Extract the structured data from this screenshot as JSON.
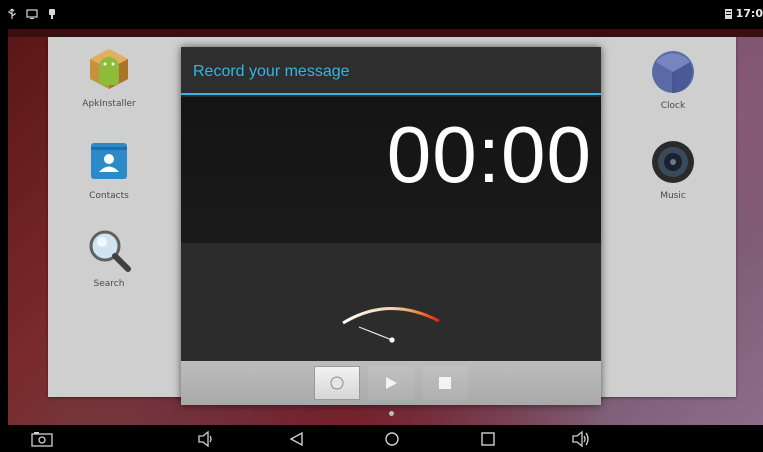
{
  "status_bar": {
    "icons_left": [
      "usb-icon",
      "screen-icon",
      "notification-icon"
    ],
    "clock": "17:0",
    "battery_icon": "sd-card-icon"
  },
  "launcher": {
    "apps_left": [
      {
        "label": "ApkInstaller",
        "icon": "apkinstaller-icon"
      },
      {
        "label": "Contacts",
        "icon": "contacts-icon"
      },
      {
        "label": "Search",
        "icon": "search-icon"
      }
    ],
    "apps_right": [
      {
        "label": "Clock",
        "icon": "clock-icon"
      },
      {
        "label": "Music",
        "icon": "music-icon"
      }
    ]
  },
  "dialog": {
    "title": "Record your message",
    "timer": "00:00",
    "accent_color": "#33b5e5",
    "controls": [
      "record-icon",
      "play-icon",
      "stop-icon"
    ]
  },
  "nav_bar": {
    "buttons": [
      "screenshot-icon",
      "volume-down-icon",
      "back-icon",
      "home-icon",
      "recents-icon",
      "volume-up-icon"
    ]
  }
}
